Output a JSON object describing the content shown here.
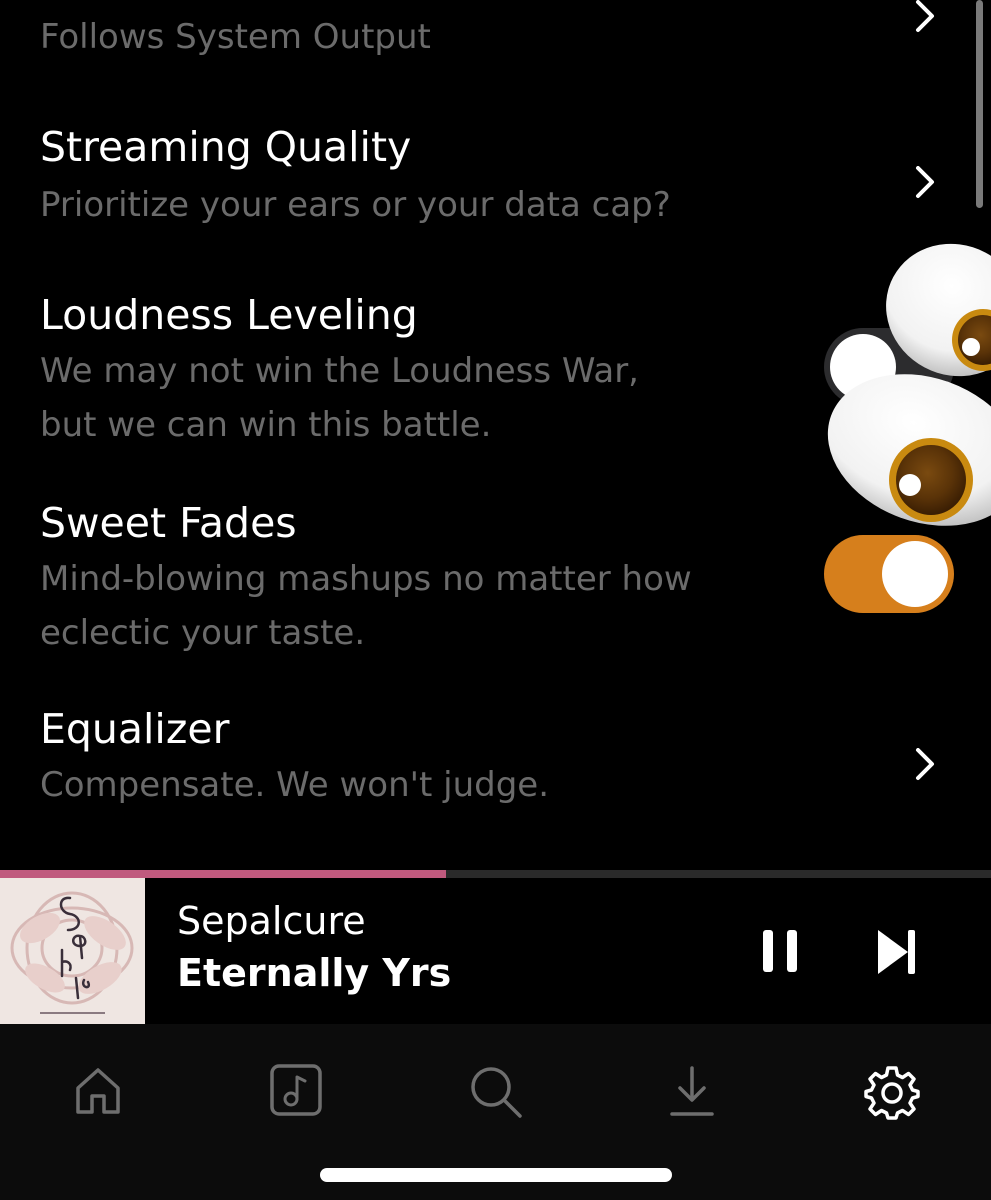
{
  "settings": {
    "output": {
      "subtitle": "Follows System Output"
    },
    "streaming_quality": {
      "title": "Streaming Quality",
      "subtitle": "Prioritize your ears or your data cap?"
    },
    "loudness_leveling": {
      "title": "Loudness Leveling",
      "subtitle_line1": "We may not win the Loudness War,",
      "subtitle_line2": "but we can win this battle.",
      "enabled": false
    },
    "sweet_fades": {
      "title": "Sweet Fades",
      "subtitle_line1": "Mind-blowing mashups no matter how",
      "subtitle_line2": "eclectic your taste.",
      "enabled": true
    },
    "equalizer": {
      "title": "Equalizer",
      "subtitle": "Compensate. We won't judge."
    }
  },
  "now_playing": {
    "artist": "Sepalcure",
    "track": "Eternally Yrs",
    "progress": 0.45,
    "progress_color": "#c05a7e"
  },
  "tabs": [
    {
      "icon": "home-icon"
    },
    {
      "icon": "library-icon"
    },
    {
      "icon": "search-icon"
    },
    {
      "icon": "download-icon"
    },
    {
      "icon": "gear-icon",
      "active": true
    }
  ],
  "colors": {
    "background": "#000000",
    "toggle_on": "#d67f1c",
    "toggle_off": "#2c2c2e",
    "subtitle": "#6b6b6b",
    "inactive_icon": "#6e6e6e",
    "active_icon": "#ffffff"
  }
}
